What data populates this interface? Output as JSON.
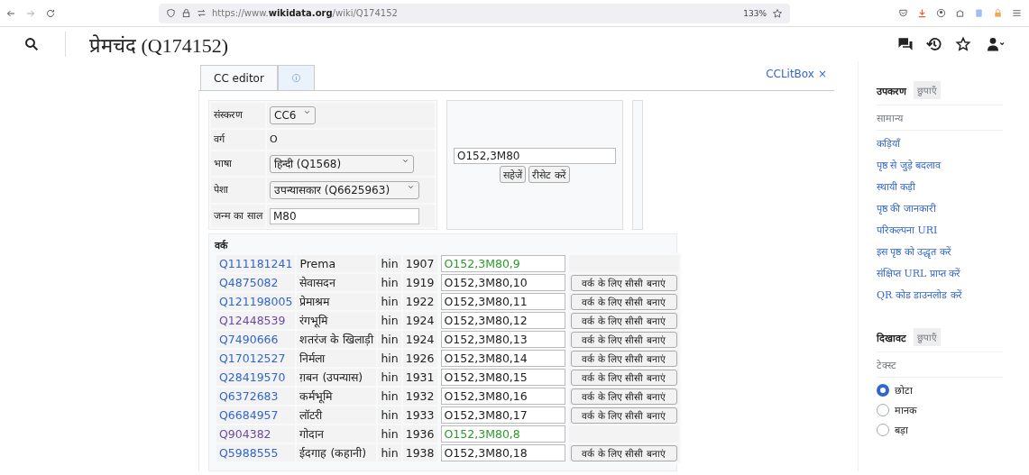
{
  "browser": {
    "url_prefix": "https://www.",
    "url_domain": "wikidata.org",
    "url_path": "/wiki/Q174152",
    "zoom": "133%"
  },
  "header": {
    "title": "प्रेमचंद (Q174152)"
  },
  "tabs": [
    {
      "kind": "text",
      "label": "CC editor",
      "selected": true
    },
    {
      "kind": "info",
      "selected": false
    }
  ],
  "close_link": {
    "label": "CCLitBox",
    "close": "×"
  },
  "form": {
    "fields": [
      {
        "kind": "select",
        "label": "संस्करण",
        "value": "CC6"
      },
      {
        "kind": "text",
        "label": "वर्ग",
        "value": "O"
      },
      {
        "kind": "select",
        "label": "भाषा",
        "value": "हिन्दी (Q1568)"
      },
      {
        "kind": "select",
        "label": "पेशा",
        "value": "उपन्यासकार (Q6625963)"
      },
      {
        "kind": "input",
        "label": "जन्म का साल",
        "value": "M80"
      }
    ]
  },
  "result": {
    "value": "O152,3M80",
    "buttons": [
      "सहेजें",
      "रीसेट करें"
    ]
  },
  "works": {
    "heading": "वर्क",
    "rows": [
      {
        "id": "Q111181241",
        "visited": false,
        "title": "Prema",
        "lang": "hin",
        "year": "1907",
        "code": "O152,3M80,9",
        "saved": true
      },
      {
        "id": "Q4875082",
        "visited": false,
        "title": "सेवासदन",
        "lang": "hin",
        "year": "1919",
        "code": "O152,3M80,10",
        "saved": false,
        "button": "वर्क के लिए सीसी बनाएं"
      },
      {
        "id": "Q121198005",
        "visited": false,
        "title": "प्रेमाश्रम",
        "lang": "hin",
        "year": "1922",
        "code": "O152,3M80,11",
        "saved": false,
        "button": "वर्क के लिए सीसी बनाएं"
      },
      {
        "id": "Q12448539",
        "visited": true,
        "title": "रंगभूमि",
        "lang": "hin",
        "year": "1924",
        "code": "O152,3M80,12",
        "saved": false,
        "button": "वर्क के लिए सीसी बनाएं"
      },
      {
        "id": "Q7490666",
        "visited": false,
        "title": "शतरंज के खिलाड़ी",
        "lang": "hin",
        "year": "1924",
        "code": "O152,3M80,13",
        "saved": false,
        "button": "वर्क के लिए सीसी बनाएं"
      },
      {
        "id": "Q17012527",
        "visited": false,
        "title": "निर्मला",
        "lang": "hin",
        "year": "1926",
        "code": "O152,3M80,14",
        "saved": false,
        "button": "वर्क के लिए सीसी बनाएं"
      },
      {
        "id": "Q28419570",
        "visited": false,
        "title": "ग़बन (उपन्यास)",
        "lang": "hin",
        "year": "1931",
        "code": "O152,3M80,15",
        "saved": false,
        "button": "वर्क के लिए सीसी बनाएं"
      },
      {
        "id": "Q6372683",
        "visited": false,
        "title": "कर्मभूमि",
        "lang": "hin",
        "year": "1932",
        "code": "O152,3M80,16",
        "saved": false,
        "button": "वर्क के लिए सीसी बनाएं"
      },
      {
        "id": "Q6684957",
        "visited": false,
        "title": "लॉटरी",
        "lang": "hin",
        "year": "1933",
        "code": "O152,3M80,17",
        "saved": false,
        "button": "वर्क के लिए सीसी बनाएं"
      },
      {
        "id": "Q904382",
        "visited": true,
        "title": "गोदान",
        "lang": "hin",
        "year": "1936",
        "code": "O152,3M80,8",
        "saved": true
      },
      {
        "id": "Q5988555",
        "visited": false,
        "title": "ईदगाह (कहानी)",
        "lang": "hin",
        "year": "1938",
        "code": "O152,3M80,18",
        "saved": false,
        "button": "वर्क के लिए सीसी बनाएं"
      }
    ]
  },
  "sidebar": [
    {
      "title": "उपकरण",
      "hide": "छुपाएँ",
      "subheading": "सामान्य",
      "kind": "links",
      "items": [
        {
          "label": "कड़ियाँ"
        },
        {
          "label": "पृष्ठ से जुड़े बदलाव"
        },
        {
          "label": "स्थायी कड़ी"
        },
        {
          "label": "पृष्ठ की जानकारी"
        },
        {
          "label": "परिकल्पना URI"
        },
        {
          "label": "इस पृष्ठ को उद्धृत करें"
        },
        {
          "label": "संक्षिप्त URL प्राप्त करें"
        },
        {
          "label": "QR कोड डाउनलोड करें"
        }
      ]
    },
    {
      "title": "दिखावट",
      "hide": "छुपाएँ",
      "subheading": "टेक्स्ट",
      "kind": "radios",
      "items": [
        {
          "label": "छोटा",
          "selected": true
        },
        {
          "label": "मानक",
          "selected": false
        },
        {
          "label": "बड़ा",
          "selected": false
        }
      ]
    }
  ]
}
